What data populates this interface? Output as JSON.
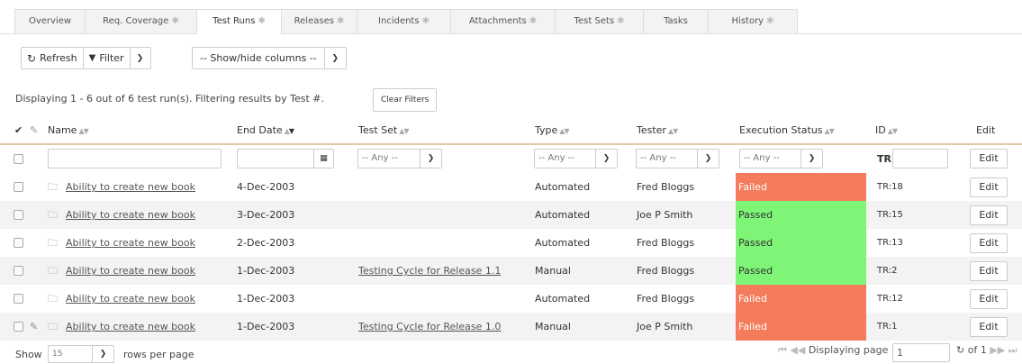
{
  "tabs": [
    {
      "label": "Overview",
      "star": false
    },
    {
      "label": "Req. Coverage",
      "star": true
    },
    {
      "label": "Test Runs",
      "star": true,
      "active": true
    },
    {
      "label": "Releases",
      "star": true
    },
    {
      "label": "Incidents",
      "star": true
    },
    {
      "label": "Attachments",
      "star": true
    },
    {
      "label": "Test Sets",
      "star": true
    },
    {
      "label": "Tasks",
      "star": false
    },
    {
      "label": "History",
      "star": true
    }
  ],
  "toolbar": {
    "refresh_label": "Refresh",
    "filter_label": "Filter",
    "columns_label": "-- Show/hide columns --",
    "clear_filters_label": "Clear Filters"
  },
  "summary": "Displaying 1 - 6 out of 6 test run(s). Filtering results by Test #.",
  "columns": {
    "name": "Name",
    "end_date": "End Date",
    "test_set": "Test Set",
    "type": "Type",
    "tester": "Tester",
    "execution_status": "Execution Status",
    "id": "ID",
    "edit": "Edit"
  },
  "filters": {
    "any_label": "-- Any --",
    "id_prefix": "TR",
    "edit_label": "Edit"
  },
  "rows": [
    {
      "name": "Ability to create new book",
      "end_date": "4-Dec-2003",
      "test_set": "",
      "type": "Automated",
      "tester": "Fred Bloggs",
      "status": "Failed",
      "id": "TR:18",
      "edit": "Edit"
    },
    {
      "name": "Ability to create new book",
      "end_date": "3-Dec-2003",
      "test_set": "",
      "type": "Automated",
      "tester": "Joe P Smith",
      "status": "Passed",
      "id": "TR:15",
      "edit": "Edit"
    },
    {
      "name": "Ability to create new book",
      "end_date": "2-Dec-2003",
      "test_set": "",
      "type": "Automated",
      "tester": "Fred Bloggs",
      "status": "Passed",
      "id": "TR:13",
      "edit": "Edit"
    },
    {
      "name": "Ability to create new book",
      "end_date": "1-Dec-2003",
      "test_set": "Testing Cycle for Release 1.1",
      "type": "Manual",
      "tester": "Fred Bloggs",
      "status": "Passed",
      "id": "TR:2",
      "edit": "Edit"
    },
    {
      "name": "Ability to create new book",
      "end_date": "1-Dec-2003",
      "test_set": "",
      "type": "Automated",
      "tester": "Fred Bloggs",
      "status": "Failed",
      "id": "TR:12",
      "edit": "Edit"
    },
    {
      "name": "Ability to create new book",
      "end_date": "1-Dec-2003",
      "test_set": "Testing Cycle for Release 1.0",
      "type": "Manual",
      "tester": "Joe P Smith",
      "status": "Failed",
      "id": "TR:1",
      "edit": "Edit",
      "attachment": true
    }
  ],
  "footer": {
    "show_label": "Show",
    "page_size": "15",
    "rows_per_page_label": "rows per page",
    "displaying_page_label": "Displaying page",
    "current_page": "1",
    "of_label": "of 1"
  },
  "colors": {
    "failed": "#f47c5c",
    "passed": "#7ef577",
    "header_rule": "#e5c9a0"
  }
}
